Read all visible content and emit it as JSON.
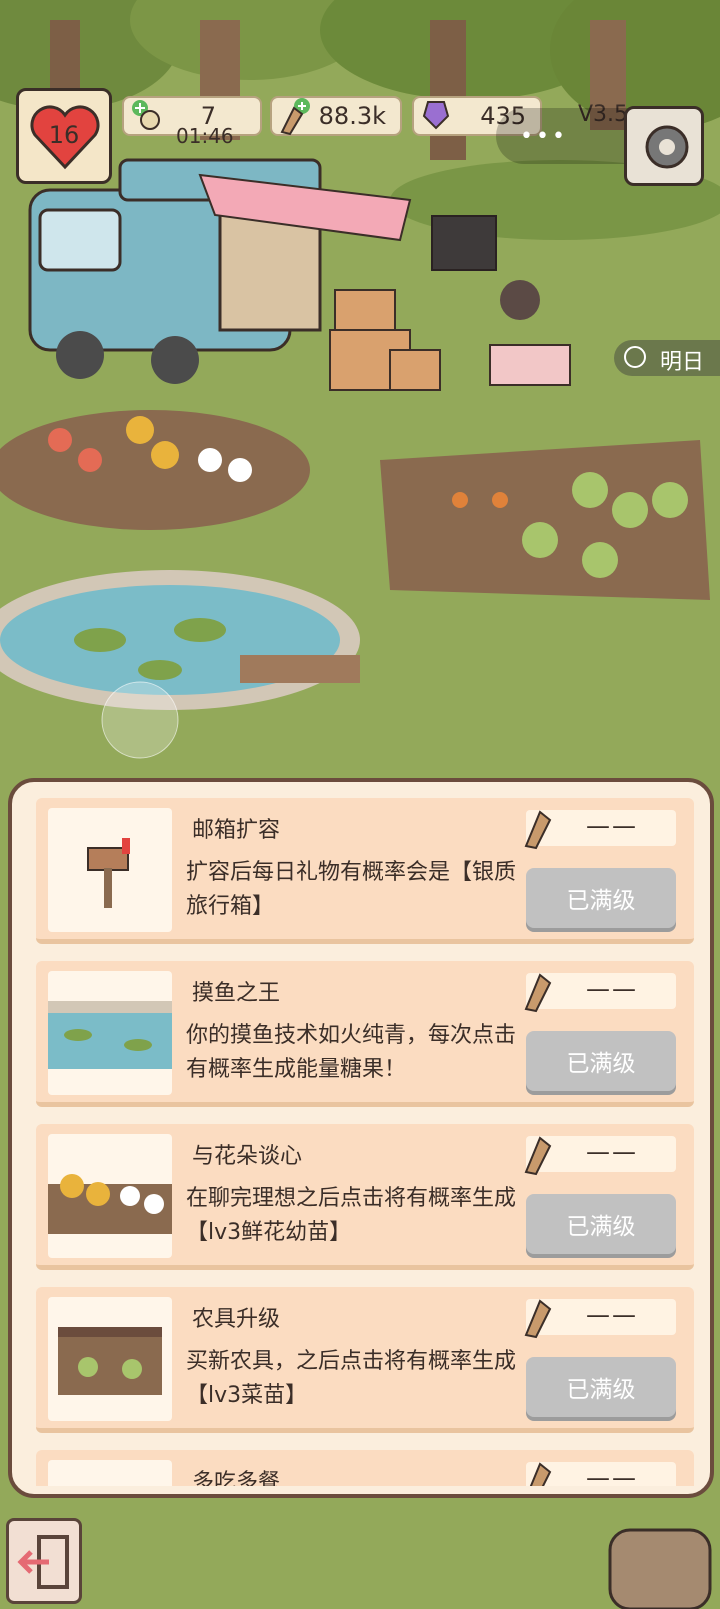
{
  "hud": {
    "hearts": "16",
    "energy": "7",
    "timer": "01:46",
    "fish": "88.3k",
    "gems": "435",
    "version": "V3.5"
  },
  "capsule": {
    "dots": "•••"
  },
  "tomorrow_label": "明日",
  "upgrades": [
    {
      "title": "邮箱扩容",
      "desc": "扩容后每日礼物有概率会是【银质旅行箱】",
      "cost": "——",
      "button": "已满级"
    },
    {
      "title": "摸鱼之王",
      "desc": "你的摸鱼技术如火纯青，每次点击有概率生成能量糖果！",
      "cost": "——",
      "button": "已满级"
    },
    {
      "title": "与花朵谈心",
      "desc": "在聊完理想之后点击将有概率生成【lv3鲜花幼苗】",
      "cost": "——",
      "button": "已满级"
    },
    {
      "title": "农具升级",
      "desc": "买新农具，之后点击将有概率生成【lv3菜苗】",
      "cost": "——",
      "button": "已满级"
    },
    {
      "title": "多吃多餐",
      "desc": "",
      "cost": "——",
      "button": ""
    }
  ],
  "colors": {
    "panel_bg": "#fbeedd",
    "card_bg": "#fbdcc1",
    "button_disabled": "#c1c1c1",
    "grass": "#93a95a",
    "outline": "#3b2e28"
  }
}
